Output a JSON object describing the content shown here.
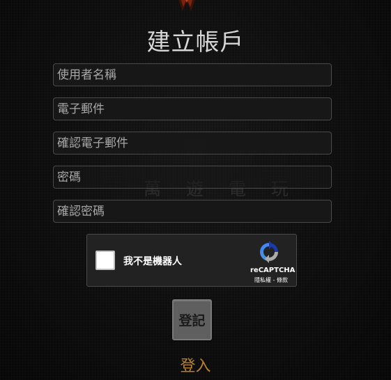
{
  "page": {
    "title": "建立帳戶",
    "watermark_text": "萬 遊 電 玩"
  },
  "form": {
    "username_placeholder": "使用者名稱",
    "email_placeholder": "電子郵件",
    "confirm_email_placeholder": "確認電子郵件",
    "password_placeholder": "密碼",
    "confirm_password_placeholder": "確認密碼",
    "submit_label": "登記"
  },
  "recaptcha": {
    "label": "我不是機器人",
    "brand": "reCAPTCHA",
    "links": "隱私權 - 條款",
    "checked": false,
    "logo_icon": "recaptcha-logo-icon"
  },
  "footer": {
    "login_label": "登入"
  },
  "colors": {
    "background": "#0d0d0d",
    "title": "#d6d6d6",
    "field_background": "#181818",
    "field_border": "#4a4a4a",
    "button_background": "#5f5f5f",
    "link": "#b9822c",
    "recaptcha_background": "#222222"
  }
}
